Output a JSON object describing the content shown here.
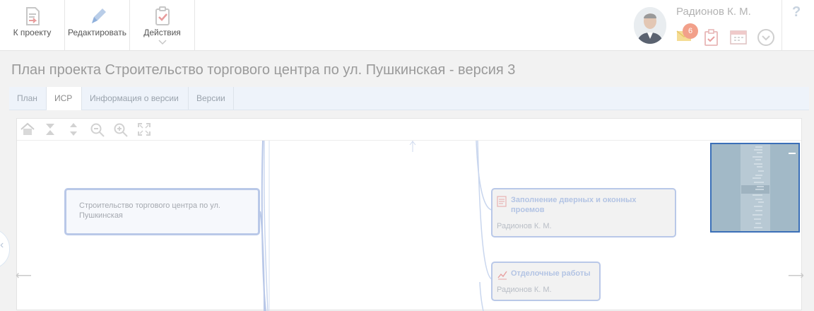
{
  "toolbar": {
    "to_project": "К проекту",
    "edit": "Редактировать",
    "actions": "Действия"
  },
  "user": {
    "name": "Радионов К. М.",
    "notifications": "6"
  },
  "help_label": "?",
  "page_title": "План проекта Строительство торгового центра по ул. Пушкинская - версия 3",
  "tabs": [
    {
      "label": "План"
    },
    {
      "label": "ИСР"
    },
    {
      "label": "Информация о версии"
    },
    {
      "label": "Версии"
    }
  ],
  "active_tab": "ИСР",
  "wbs": {
    "root": "Строительство торгового центра по ул. Пушкинская",
    "tasks": [
      {
        "title": "Заполнение дверных и оконных проемов",
        "owner": "Радионов К. М.",
        "icon": "document-icon"
      },
      {
        "title": "Отделочные работы",
        "owner": "Радионов К. М.",
        "icon": "chart-icon"
      }
    ]
  },
  "colors": {
    "accent": "#3b6fb8",
    "node_border": "#b9c8e8",
    "badge": "#f2a08a"
  }
}
